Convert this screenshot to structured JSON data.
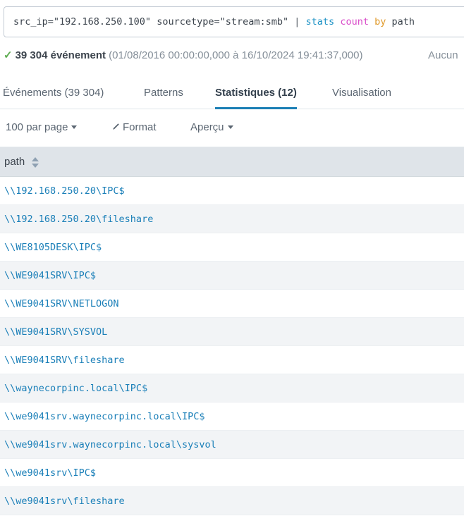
{
  "search": {
    "query_full": "src_ip=\"192.168.250.100\" sourcetype=\"stream:smb\" | stats count by path",
    "tokens": {
      "plain1": "src_ip=\"192.168.250.100\" sourcetype=\"stream:smb\" ",
      "pipe": "| ",
      "command": "stats ",
      "function": "count ",
      "keyword": "by ",
      "field": "path"
    }
  },
  "results_header": {
    "check_icon": "checkmark-icon",
    "count_label": "39 304 événement",
    "time_range": "(01/08/2016 00:00:00,000 à 16/10/2024 19:41:37,000)",
    "job_status": "Aucun"
  },
  "tabs": [
    {
      "label": "Événements (39 304)",
      "active": false
    },
    {
      "label": "Patterns",
      "active": false
    },
    {
      "label": "Statistiques (12)",
      "active": true
    },
    {
      "label": "Visualisation",
      "active": false
    }
  ],
  "toolbar": [
    {
      "label": "100 par page",
      "caret": true,
      "icon": null
    },
    {
      "label": "Format",
      "caret": false,
      "icon": "pencil-icon"
    },
    {
      "label": "Aperçu",
      "caret": true,
      "icon": null
    }
  ],
  "table": {
    "columns": [
      {
        "label": "path",
        "sort_icon": "sort-updown-icon"
      }
    ],
    "rows": [
      {
        "path": "\\\\192.168.250.20\\IPC$"
      },
      {
        "path": "\\\\192.168.250.20\\fileshare"
      },
      {
        "path": "\\\\WE8105DESK\\IPC$"
      },
      {
        "path": "\\\\WE9041SRV\\IPC$"
      },
      {
        "path": "\\\\WE9041SRV\\NETLOGON"
      },
      {
        "path": "\\\\WE9041SRV\\SYSVOL"
      },
      {
        "path": "\\\\WE9041SRV\\fileshare"
      },
      {
        "path": "\\\\waynecorpinc.local\\IPC$"
      },
      {
        "path": "\\\\we9041srv.waynecorpinc.local\\IPC$"
      },
      {
        "path": "\\\\we9041srv.waynecorpinc.local\\sysvol"
      },
      {
        "path": "\\\\we9041srv\\IPC$"
      },
      {
        "path": "\\\\we9041srv\\fileshare"
      }
    ]
  },
  "colors": {
    "accent_blue": "#1b7fb5",
    "link_blue": "#1a7fb8",
    "command_blue": "#1e93c6",
    "function_magenta": "#d94bc9",
    "keyword_orange": "#e09a2b",
    "success_green": "#5bab4e",
    "header_gray": "#dfe4e9",
    "row_alt_gray": "#f2f4f6"
  }
}
